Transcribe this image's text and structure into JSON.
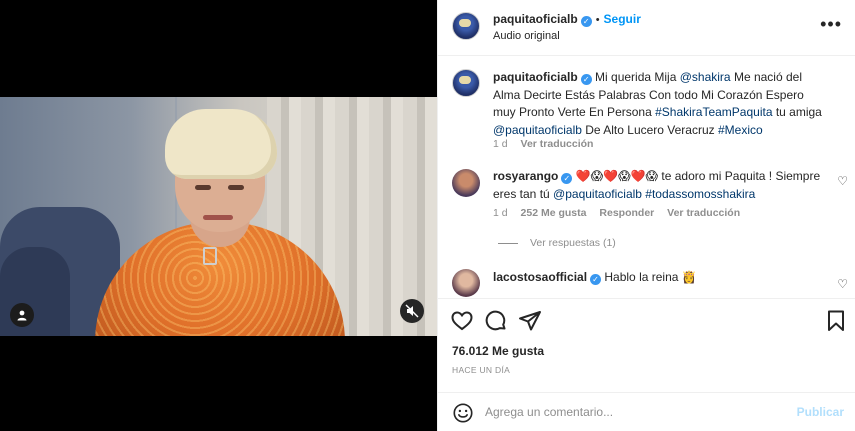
{
  "post": {
    "username": "paquitaoficialb",
    "follow_label": "Seguir",
    "audio_label": "Audio original"
  },
  "caption": {
    "username": "paquitaoficialb",
    "text_before_mention": "Mi querida Mija ",
    "mention_shakira": "@shakira",
    "text_mid": " Me nació del Alma Decirte Estás Palabras Con todo Mi Corazón Espero muy Pronto Verte En Persona ",
    "hashtag_1": "#ShakiraTeamPaquita",
    "text_after_hashtag": " tu amiga ",
    "mention_self": "@paquitaoficialb",
    "text_location": " De Alto Lucero Veracruz ",
    "hashtag_2": "#Mexico",
    "age": "1 d",
    "translate": "Ver traducción"
  },
  "comments": [
    {
      "username": "rosyarango",
      "emojis": "❤️😱❤️😱❤️😱",
      "text_a": " te adoro mi Paquita ! Siempre eres tan tú ",
      "mention": "@paquitaoficialb",
      "hashtag": "#todassomosshakira",
      "age": "1 d",
      "likes": "252 Me gusta",
      "reply": "Responder",
      "translate": "Ver traducción",
      "replies": "Ver respuestas (1)"
    },
    {
      "username": "lacostosaofficial",
      "text": "Hablo la reina 👸"
    }
  ],
  "stats": {
    "likes": "76.012 Me gusta",
    "when": "HACE UN DÍA"
  },
  "composer": {
    "placeholder": "Agrega un comentario...",
    "publish": "Publicar"
  },
  "icons": {
    "more": "more-horizontal-icon",
    "like": "heart-icon",
    "comment": "comment-icon",
    "share": "share-icon",
    "save": "bookmark-icon",
    "emoji": "emoji-icon",
    "mute": "muted-speaker-icon",
    "user": "user-icon"
  },
  "colors": {
    "accent": "#0095f6",
    "verified": "#3897f0",
    "link": "#00376b"
  }
}
